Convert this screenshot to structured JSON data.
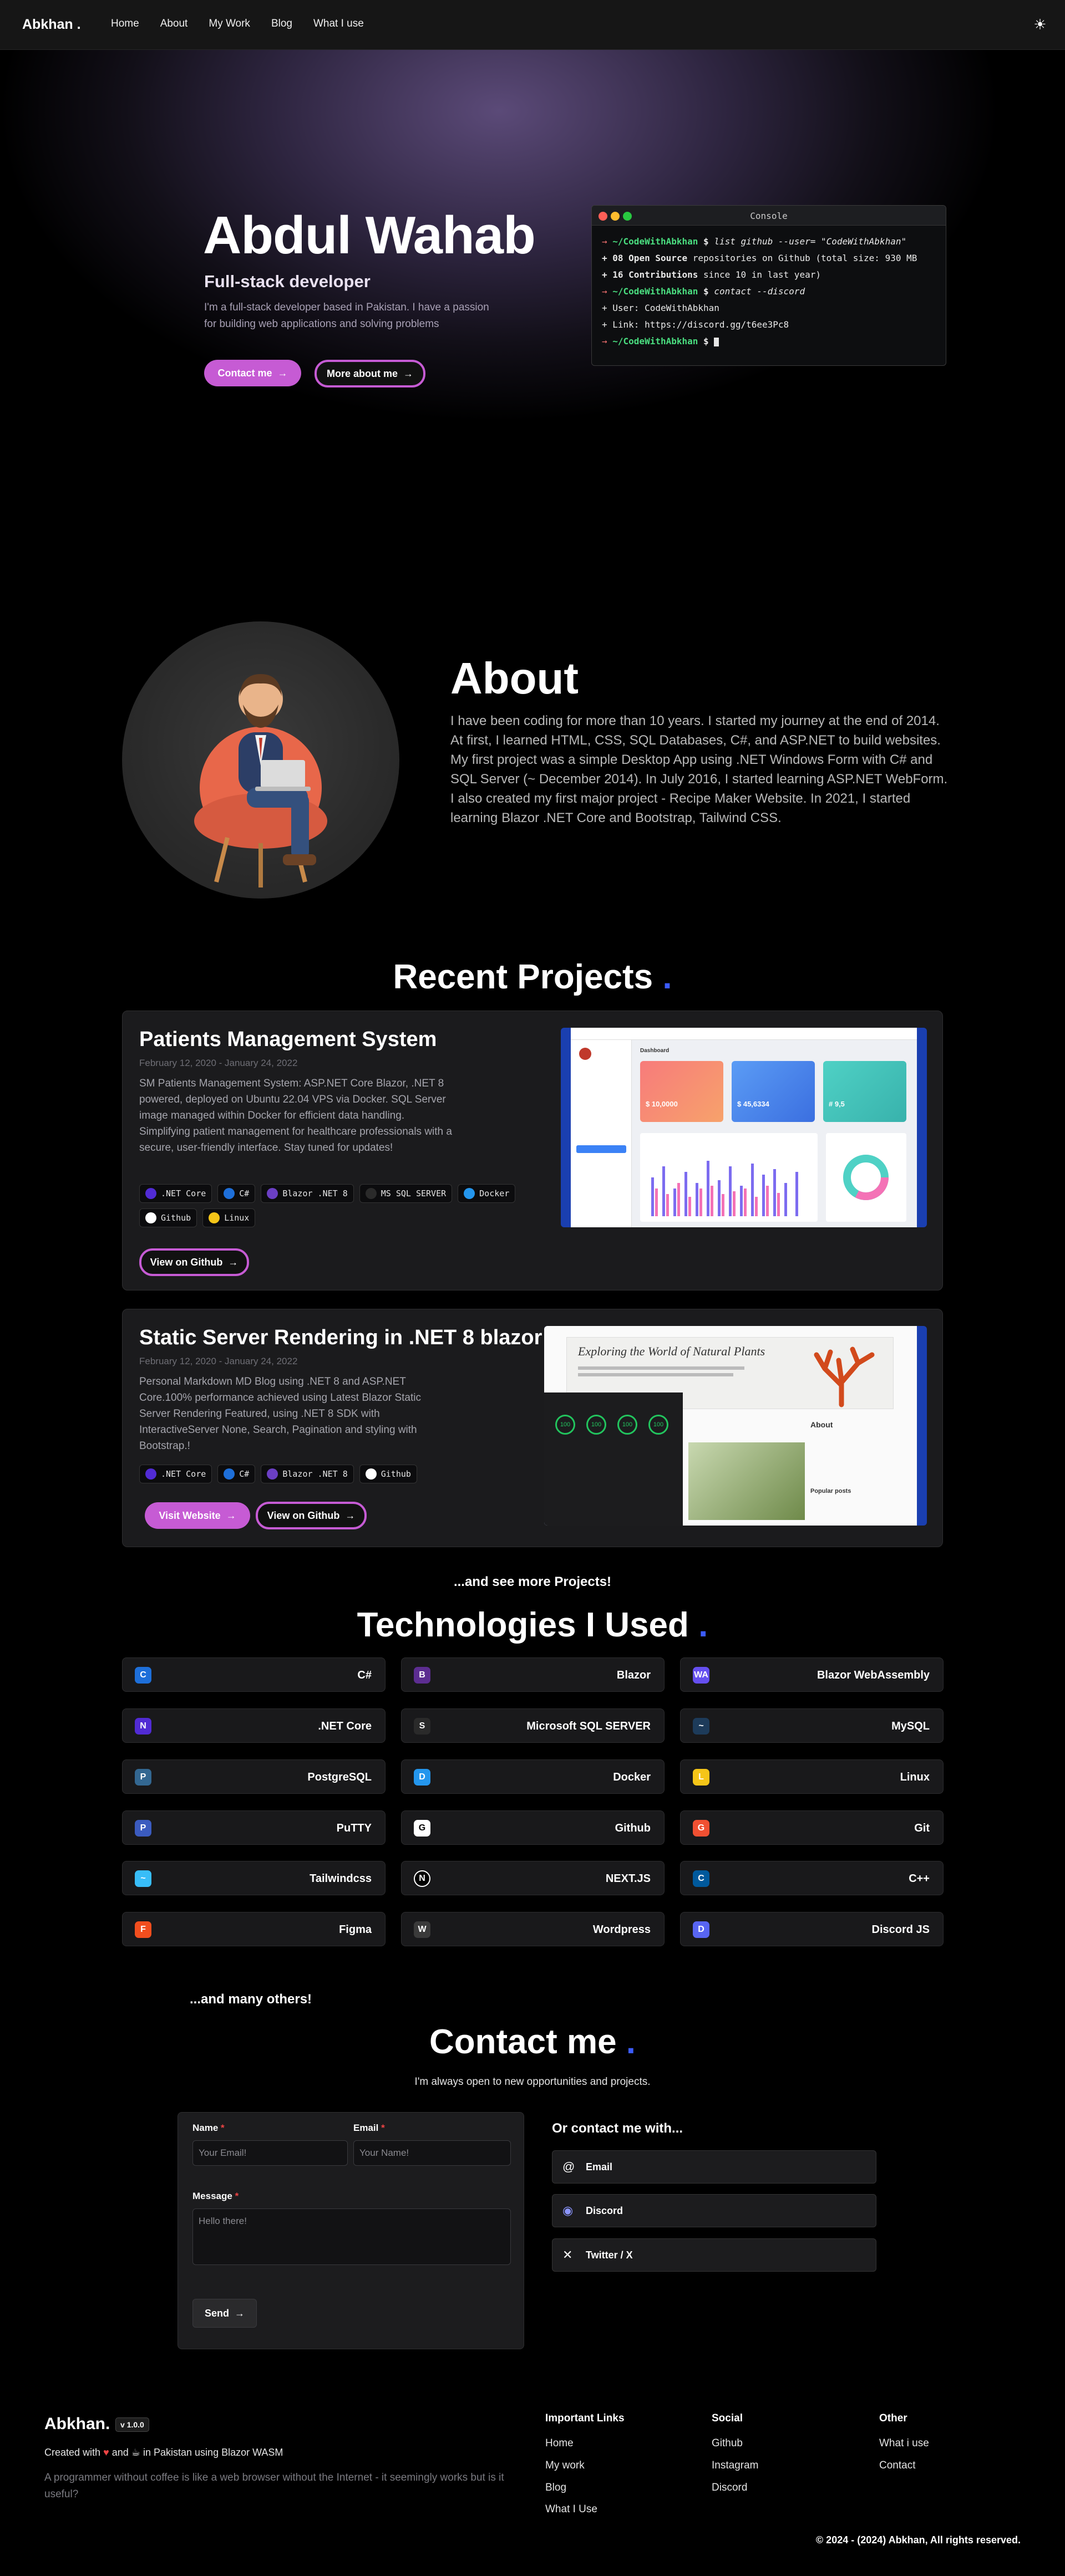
{
  "nav": {
    "logo": "Abkhan .",
    "links": [
      "Home",
      "About",
      "My Work",
      "Blog",
      "What I use"
    ]
  },
  "hero": {
    "name": "Abdul Wahab",
    "role": "Full-stack developer",
    "description": "I'm a full-stack developer based in Pakistan. I have a passion for building web applications and solving problems",
    "contact_btn": "Contact me",
    "more_btn": "More about me"
  },
  "console": {
    "title": "Console",
    "prompt": "~/CodeWithAbkhan",
    "cmd1": "list github --user= \"CodeWithAbkhan\"",
    "line1_count": "08",
    "line1_bold": "Open Source",
    "line1_rest": "repositories on Github (total size: 930 MB",
    "line2_count": "16",
    "line2_bold": "Contributions",
    "line2_rest": "since 10 in last year)",
    "cmd2": "contact --discord",
    "user_line": "User: CodeWithAbkhan",
    "link_line": "Link: https://discord.gg/t6ee3Pc8"
  },
  "about": {
    "title": "About",
    "text": "I have been coding for more than 10 years. I started my journey at the end of 2014. At first, I learned HTML, CSS, SQL Databases, C#, and ASP.NET to build websites. My first project was a simple Desktop App using .NET Windows Form with C# and SQL Server (~ December 2014). In July 2016, I started learning ASP.NET WebForm. I also created my first major project - Recipe Maker Website. In 2021, I started learning Blazor .NET Core and Bootstrap, Tailwind CSS."
  },
  "projects": {
    "title": "Recent Projects",
    "items": [
      {
        "title": "Patients Management System",
        "date": "February 12, 2020 - January 24, 2022",
        "description": "SM Patients Management System: ASP.NET Core Blazor, .NET 8 powered, deployed on Ubuntu 22.04 VPS via Docker. SQL Server image managed within Docker for efficient data handling. Simplifying patient management for healthcare professionals with a secure, user-friendly interface. Stay tuned for updates!",
        "tags": [
          ".NET Core",
          "C#",
          "Blazor .NET 8",
          "MS SQL SERVER",
          "Docker",
          "Github",
          "Linux"
        ],
        "github_btn": "View on Github",
        "dashboard_label": "Dashboard",
        "stats": [
          "$ 10,0000",
          "$ 45,6334",
          "# 9,5"
        ]
      },
      {
        "title": "Static Server Rendering in .NET 8 blazor",
        "date": "February 12, 2020 - January 24, 2022",
        "description": "Personal Markdown MD Blog using .NET 8 and ASP.NET Core.100% performance achieved using Latest Blazor Static Server Rendering Featured, using .NET 8 SDK with InteractiveServer None, Search, Pagination and styling with Bootstrap.!",
        "tags": [
          ".NET Core",
          "C#",
          "Blazor .NET 8",
          "Github"
        ],
        "website_btn": "Visit Website",
        "github_btn": "View on Github",
        "blog_heading": "Exploring the World of Natural Plants",
        "blog_about": "About",
        "blog_popular": "Popular posts",
        "lighthouse": [
          "100",
          "100",
          "100",
          "100"
        ]
      }
    ],
    "see_more": "...and see more Projects!"
  },
  "technologies": {
    "title": "Technologies I Used",
    "items": [
      {
        "name": "C#",
        "icon": "csharp-icon",
        "color": "#1e6fd9",
        "glyph": "C"
      },
      {
        "name": "Blazor",
        "icon": "blazor-icon",
        "color": "#5c2d91",
        "glyph": "B"
      },
      {
        "name": "Blazor WebAssembly",
        "icon": "webassembly-icon",
        "color": "#654ff0",
        "glyph": "WA"
      },
      {
        "name": ".NET Core",
        "icon": "dotnet-icon",
        "color": "#512bd4",
        "glyph": "N"
      },
      {
        "name": "Microsoft SQL SERVER",
        "icon": "sqlserver-icon",
        "color": "#2a2a2a",
        "glyph": "S"
      },
      {
        "name": "MySQL",
        "icon": "mysql-icon",
        "color": "#1d3b5a",
        "glyph": "~"
      },
      {
        "name": "PostgreSQL",
        "icon": "postgresql-icon",
        "color": "#336791",
        "glyph": "P"
      },
      {
        "name": "Docker",
        "icon": "docker-icon",
        "color": "#2496ed",
        "glyph": "D"
      },
      {
        "name": "Linux",
        "icon": "linux-icon",
        "color": "#f5c518",
        "glyph": "L"
      },
      {
        "name": "PuTTY",
        "icon": "putty-icon",
        "color": "#3b5bbf",
        "glyph": "P"
      },
      {
        "name": "Github",
        "icon": "github-icon",
        "color": "#ffffff",
        "glyph": "G"
      },
      {
        "name": "Git",
        "icon": "git-icon",
        "color": "#f05032",
        "glyph": "G"
      },
      {
        "name": "Tailwindcss",
        "icon": "tailwind-icon",
        "color": "#38bdf8",
        "glyph": "~"
      },
      {
        "name": "NEXT.JS",
        "icon": "nextjs-icon",
        "color": "#000000",
        "glyph": "N"
      },
      {
        "name": "C++",
        "icon": "cpp-icon",
        "color": "#00599c",
        "glyph": "C"
      },
      {
        "name": "Figma",
        "icon": "figma-icon",
        "color": "#f24e1e",
        "glyph": "F"
      },
      {
        "name": "Wordpress",
        "icon": "wordpress-icon",
        "color": "#3a3a3a",
        "glyph": "W"
      },
      {
        "name": "Discord JS",
        "icon": "discordjs-icon",
        "color": "#5865f2",
        "glyph": "D"
      }
    ],
    "many_others": "...and many others!"
  },
  "contact": {
    "title": "Contact me",
    "subtitle": "I'm always open to new opportunities and projects.",
    "name_label": "Name",
    "name_placeholder": "Your Email!",
    "email_label": "Email",
    "email_placeholder": "Your Name!",
    "message_label": "Message",
    "message_placeholder": "Hello there!",
    "send_btn": "Send",
    "or_contact": "Or contact me with...",
    "buttons": [
      "Email",
      "Discord",
      "Twitter / X"
    ]
  },
  "footer": {
    "logo": "Abkhan.",
    "version": "v 1.0.0",
    "created_pre": "Created with",
    "created_and": "and",
    "created_post": "in Pakistan using Blazor WASM",
    "quote": "A programmer without coffee is like a web browser without the Internet - it seemingly works but is it useful?",
    "important_title": "Important Links",
    "important_links": [
      "Home",
      "My work",
      "Blog",
      "What I Use"
    ],
    "social_title": "Social",
    "social_links": [
      "Github",
      "Instagram",
      "Discord"
    ],
    "other_title": "Other",
    "other_links": [
      "What i use",
      "Contact"
    ],
    "copyright": "© 2024 - (2024) Abkhan, All rights reserved."
  },
  "colors": {
    "accent": "#c65bd4",
    "blue_dot": "#3b5bff",
    "background": "#000000"
  }
}
